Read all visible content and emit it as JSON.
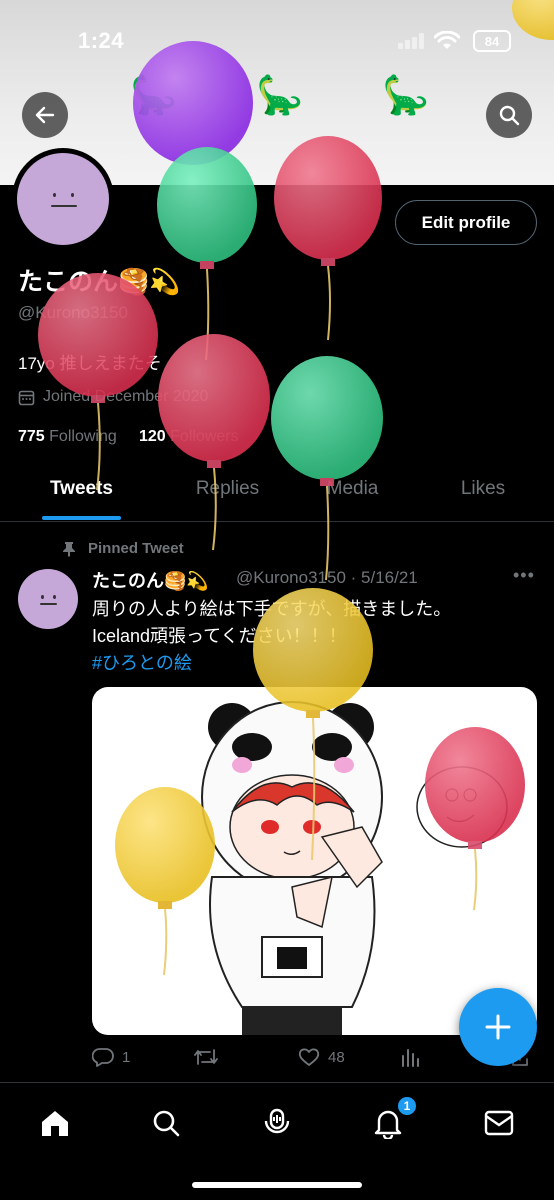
{
  "status_bar": {
    "time": "1:24",
    "battery": "84"
  },
  "header": {
    "back_icon": "back-arrow-icon",
    "search_icon": "search-icon"
  },
  "profile": {
    "display_name": "たこのん🥞💫",
    "handle": "@Kurono3150",
    "bio": "17yo 推しえまたそ",
    "joined": "Joined December 2020",
    "following_count": "775",
    "following_label": "Following",
    "followers_count": "120",
    "followers_label": "Followers",
    "edit_profile_label": "Edit profile"
  },
  "tabs": [
    {
      "label": "Tweets",
      "active": true
    },
    {
      "label": "Replies",
      "active": false
    },
    {
      "label": "Media",
      "active": false
    },
    {
      "label": "Likes",
      "active": false
    }
  ],
  "pinned_tweet": {
    "pinned_label": "Pinned Tweet",
    "author_name": "たこのん🥞💫",
    "author_handle": "@Kurono3150",
    "date": "· 5/16/21",
    "text_line1": "周りの人より絵は下手ですが、描きました。",
    "text_line2": "Iceland頑張ってください！！！",
    "hashtag": "#ひろとの絵",
    "replies": "1",
    "retweets": "",
    "likes": "48"
  },
  "nav": {
    "notifications_badge": "1"
  },
  "colors": {
    "accent": "#1d9bf0",
    "background": "#000000",
    "muted": "#71767b"
  }
}
